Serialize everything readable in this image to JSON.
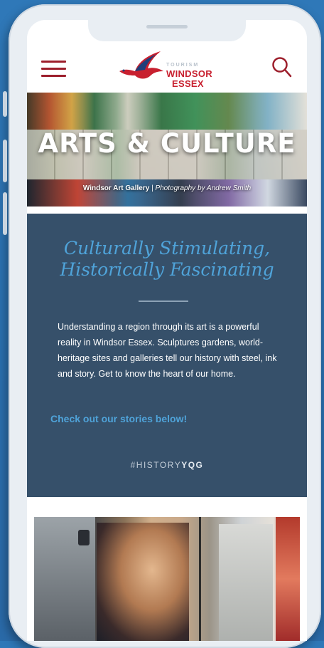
{
  "header": {
    "menu_icon": "hamburger-menu-icon",
    "logo": {
      "tourism": "TOURISM",
      "line1": "WINDSOR",
      "line2": "ESSEX",
      "brand_color": "#c8202f"
    },
    "search_icon": "search-icon"
  },
  "hero": {
    "title": "ARTS & CULTURE",
    "caption_name": "Windsor Art Gallery",
    "caption_separator": " | ",
    "caption_photo": "Photography by Andrew Smith"
  },
  "content": {
    "tagline_line1": "Culturally Stimulating,",
    "tagline_line2": "Historically Fascinating",
    "body": "Understanding a region through its art is a powerful reality in Windsor Essex. Sculptures gardens, world-heritage sites and galleries tell our history with steel, ink and story. Get to know the heart of our home.",
    "cta": "Check out our stories below!",
    "hashtag_prefix": "#HISTORY",
    "hashtag_suffix": "YQG",
    "panel_color": "#36506a",
    "accent_color": "#4fa3d9"
  }
}
